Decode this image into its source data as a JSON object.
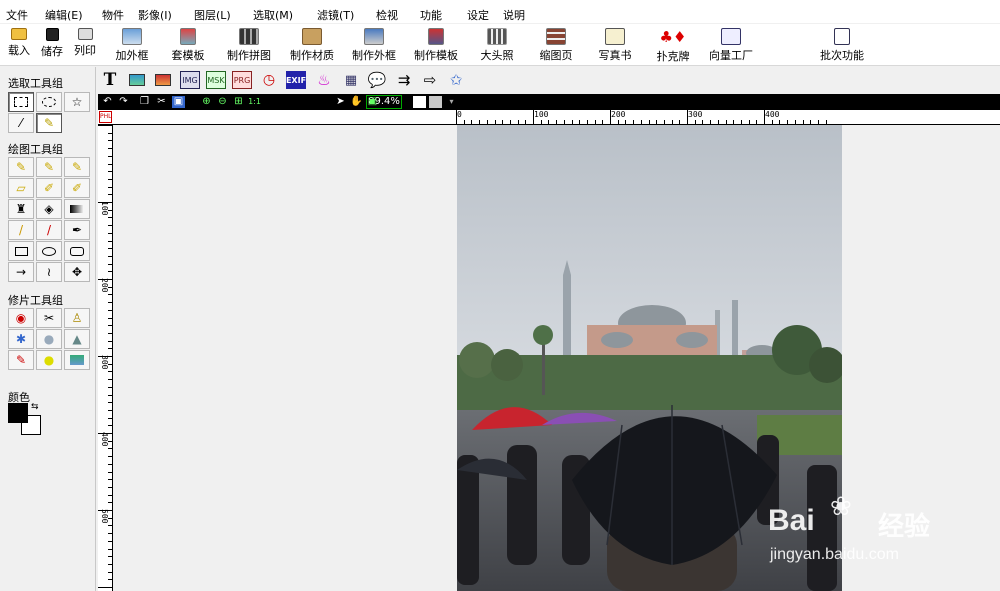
{
  "menu": [
    "文件",
    "编辑(E)",
    "物件",
    "影像(I)",
    "图层(L)",
    "选取(M)",
    "滤镜(T)",
    "检视",
    "功能",
    "设定",
    "说明"
  ],
  "toolbar": {
    "load": "载入",
    "save": "储存",
    "print": "列印",
    "add_frame": "加外框",
    "template": "套模板",
    "make_collage": "制作拼图",
    "make_material": "制作材质",
    "make_frame": "制作外框",
    "make_template": "制作模板",
    "headshot": "大头照",
    "thumbnail_page": "缩图页",
    "photo_book": "写真书",
    "poker": "扑克牌",
    "vector_factory": "向量工厂",
    "batch": "批次功能"
  },
  "panel": {
    "select_group": "选取工具组",
    "draw_group": "绘图工具组",
    "retouch_group": "修片工具组",
    "color": "颜色"
  },
  "toolbar2": {
    "text_tool": "T",
    "img_tag": "IMG",
    "msk_tag": "MSK",
    "prg_tag": "PRG",
    "exif_tag": "EXIF"
  },
  "zoom": {
    "value": "89.4%"
  },
  "ruler": {
    "h_labels": [
      "0",
      "100",
      "200",
      "300",
      "400"
    ],
    "v_labels": [
      "100",
      "200",
      "300",
      "400",
      "500"
    ],
    "corner": "PHL"
  },
  "watermark": {
    "brand_text": "Bai",
    "brand_text2": "经验",
    "url": "jingyan.baidu.com"
  },
  "colors": {
    "fg": "#000000",
    "bg": "#ffffff",
    "zoombar": "#000000",
    "accent_green": "#00aa00"
  }
}
